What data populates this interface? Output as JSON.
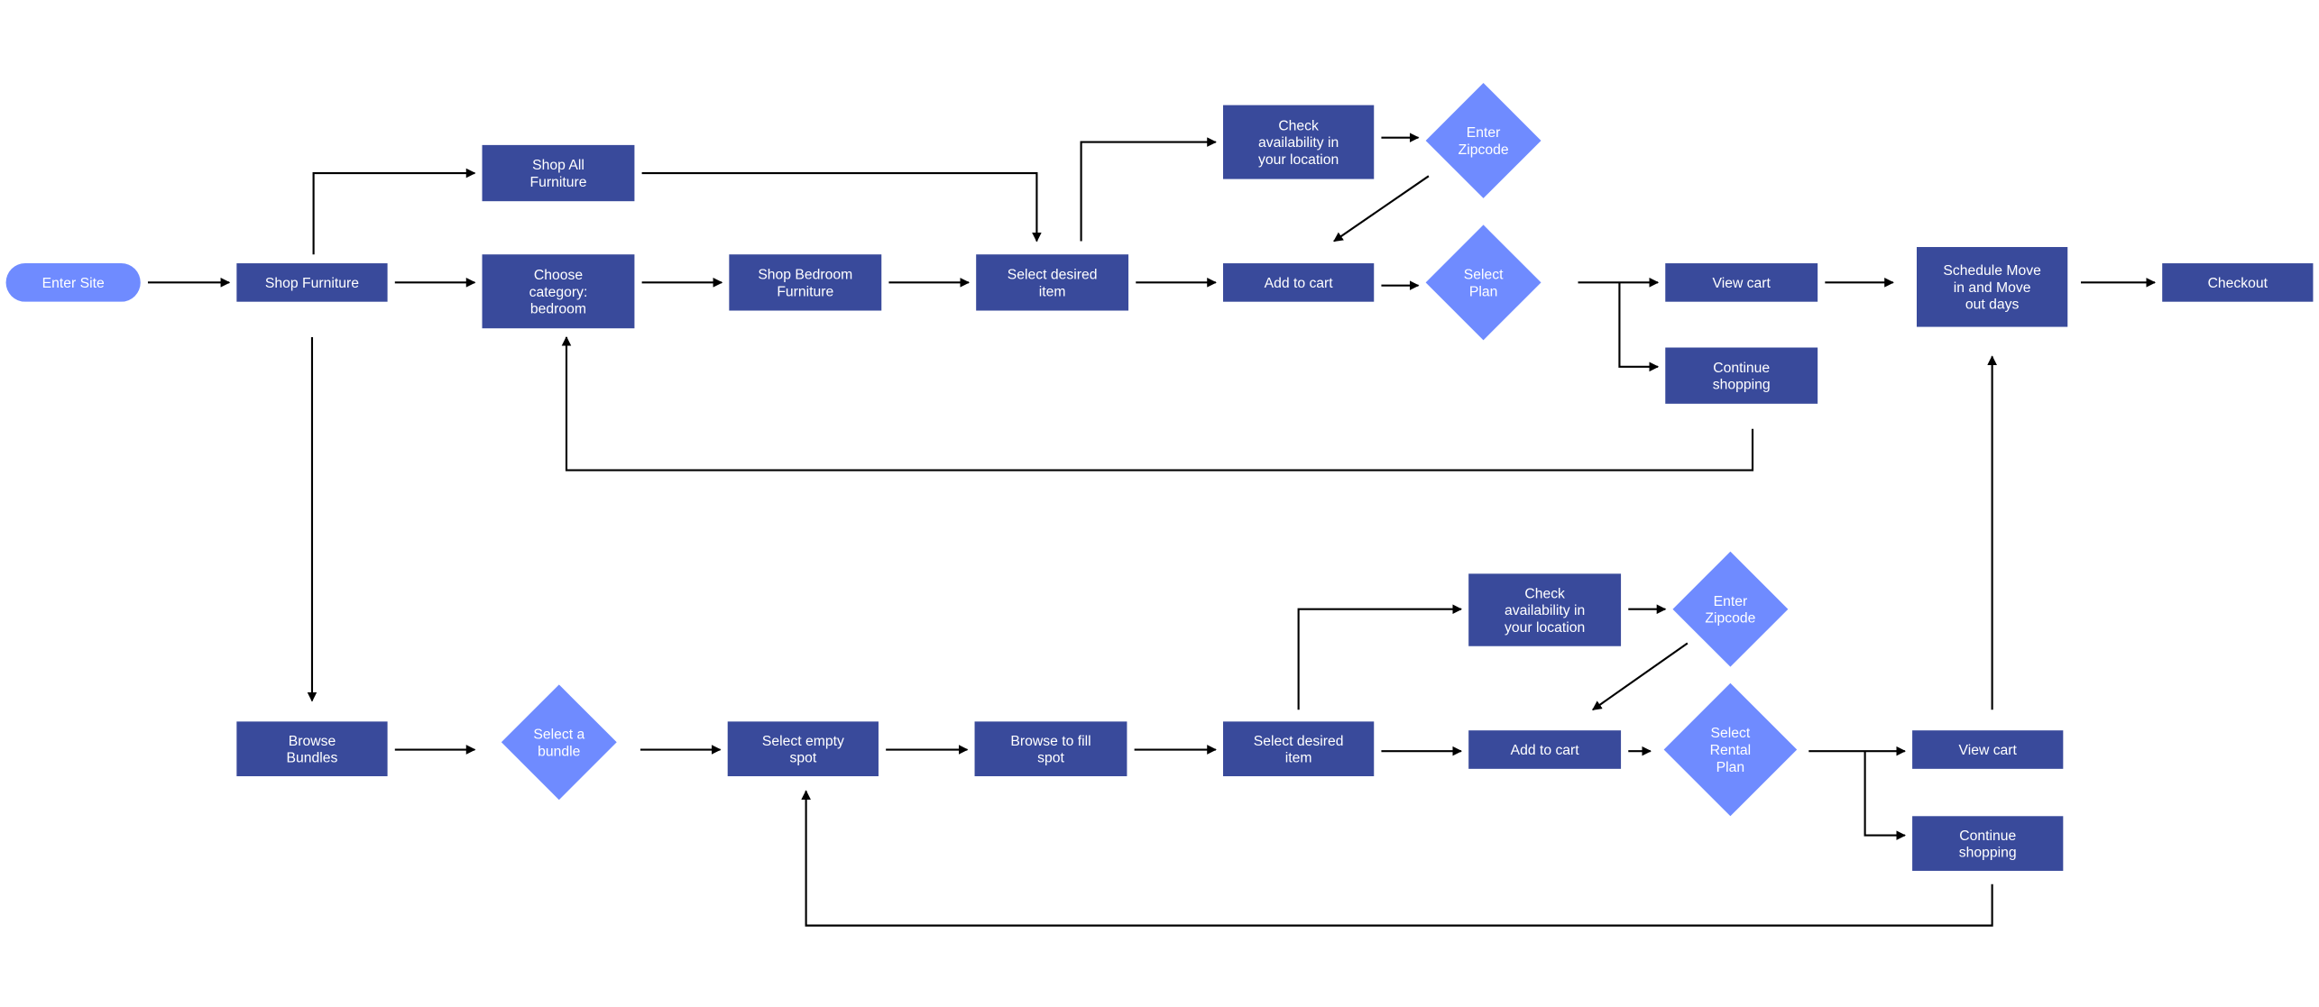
{
  "colors": {
    "process": "#394a9b",
    "decision": "#6f8bff",
    "terminal": "#6f8bff",
    "connector": "#000000",
    "background": "#ffffff"
  },
  "nodes": {
    "enter_site": {
      "type": "terminal",
      "label": [
        "Enter Site"
      ]
    },
    "shop_furniture": {
      "type": "process",
      "label": [
        "Shop Furniture"
      ]
    },
    "shop_all_furniture": {
      "type": "process",
      "label": [
        "Shop All",
        "Furniture"
      ]
    },
    "choose_category": {
      "type": "process",
      "label": [
        "Choose",
        "category:",
        "bedroom"
      ]
    },
    "shop_bedroom": {
      "type": "process",
      "label": [
        "Shop Bedroom",
        "Furniture"
      ]
    },
    "select_item_top": {
      "type": "process",
      "label": [
        "Select desired",
        "item"
      ]
    },
    "check_avail_top": {
      "type": "process",
      "label": [
        "Check",
        "availability in",
        "your location"
      ]
    },
    "zipcode_top": {
      "type": "decision",
      "label": [
        "Enter",
        "Zipcode"
      ]
    },
    "add_cart_top": {
      "type": "process",
      "label": [
        "Add to cart"
      ]
    },
    "select_plan": {
      "type": "decision",
      "label": [
        "Select",
        "Plan"
      ]
    },
    "view_cart_top": {
      "type": "process",
      "label": [
        "View cart"
      ]
    },
    "continue_top": {
      "type": "process",
      "label": [
        "Continue",
        "shopping"
      ]
    },
    "schedule_move": {
      "type": "process",
      "label": [
        "Schedule Move",
        "in and Move",
        "out days"
      ]
    },
    "checkout": {
      "type": "process",
      "label": [
        "Checkout"
      ]
    },
    "browse_bundles": {
      "type": "process",
      "label": [
        "Browse",
        "Bundles"
      ]
    },
    "select_bundle": {
      "type": "decision",
      "label": [
        "Select a",
        "bundle"
      ]
    },
    "select_empty_spot": {
      "type": "process",
      "label": [
        "Select empty",
        "spot"
      ]
    },
    "browse_fill_spot": {
      "type": "process",
      "label": [
        "Browse to fill",
        "spot"
      ]
    },
    "select_item_bottom": {
      "type": "process",
      "label": [
        "Select desired",
        "item"
      ]
    },
    "check_avail_bottom": {
      "type": "process",
      "label": [
        "Check",
        "availability in",
        "your location"
      ]
    },
    "zipcode_bottom": {
      "type": "decision",
      "label": [
        "Enter",
        "Zipcode"
      ]
    },
    "add_cart_bottom": {
      "type": "process",
      "label": [
        "Add to cart"
      ]
    },
    "select_rental_plan": {
      "type": "decision",
      "label": [
        "Select",
        "Rental",
        "Plan"
      ]
    },
    "view_cart_bottom": {
      "type": "process",
      "label": [
        "View cart"
      ]
    },
    "continue_bottom": {
      "type": "process",
      "label": [
        "Continue",
        "shopping"
      ]
    }
  },
  "edges": [
    [
      "enter_site",
      "shop_furniture"
    ],
    [
      "shop_furniture",
      "choose_category"
    ],
    [
      "shop_furniture",
      "shop_all_furniture"
    ],
    [
      "shop_all_furniture",
      "select_item_top"
    ],
    [
      "choose_category",
      "shop_bedroom"
    ],
    [
      "shop_bedroom",
      "select_item_top"
    ],
    [
      "select_item_top",
      "add_cart_top"
    ],
    [
      "select_item_top",
      "check_avail_top"
    ],
    [
      "check_avail_top",
      "zipcode_top"
    ],
    [
      "zipcode_top",
      "add_cart_top"
    ],
    [
      "add_cart_top",
      "select_plan"
    ],
    [
      "select_plan",
      "view_cart_top"
    ],
    [
      "select_plan",
      "continue_top"
    ],
    [
      "view_cart_top",
      "schedule_move"
    ],
    [
      "schedule_move",
      "checkout"
    ],
    [
      "continue_top",
      "choose_category"
    ],
    [
      "shop_furniture",
      "browse_bundles"
    ],
    [
      "browse_bundles",
      "select_bundle"
    ],
    [
      "select_bundle",
      "select_empty_spot"
    ],
    [
      "select_empty_spot",
      "browse_fill_spot"
    ],
    [
      "browse_fill_spot",
      "select_item_bottom"
    ],
    [
      "select_item_bottom",
      "add_cart_bottom"
    ],
    [
      "select_item_bottom",
      "check_avail_bottom"
    ],
    [
      "check_avail_bottom",
      "zipcode_bottom"
    ],
    [
      "zipcode_bottom",
      "add_cart_bottom"
    ],
    [
      "add_cart_bottom",
      "select_rental_plan"
    ],
    [
      "select_rental_plan",
      "view_cart_bottom"
    ],
    [
      "select_rental_plan",
      "continue_bottom"
    ],
    [
      "view_cart_bottom",
      "schedule_move"
    ],
    [
      "continue_bottom",
      "select_empty_spot"
    ]
  ]
}
